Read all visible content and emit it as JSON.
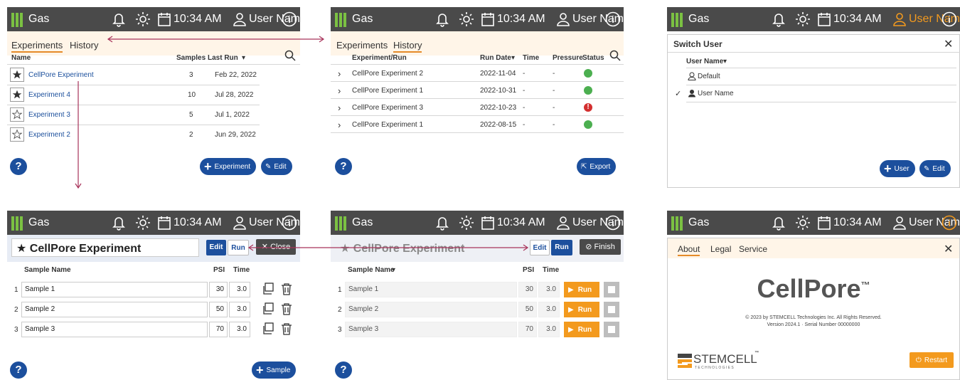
{
  "topbar": {
    "app_name": "Gas",
    "time": "10:34 AM",
    "user_name": "User Name",
    "accent_color": "#f39a1e",
    "bar_color": "#4a4a4a"
  },
  "tabs": {
    "experiments": "Experiments",
    "history": "History"
  },
  "experiments_list": {
    "col_name": "Name",
    "col_samples": "Samples",
    "col_last_run": "Last Run",
    "rows": [
      {
        "name": "CellPore Experiment",
        "samples": "3",
        "last_run": "Feb 22, 2022",
        "starred": true
      },
      {
        "name": "Experiment 4",
        "samples": "10",
        "last_run": "Jul 28, 2022",
        "starred": true
      },
      {
        "name": "Experiment 3",
        "samples": "5",
        "last_run": "Jul 1, 2022",
        "starred": false
      },
      {
        "name": "Experiment 2",
        "samples": "2",
        "last_run": "Jun 29, 2022",
        "starred": false
      }
    ],
    "add_button": "Experiment",
    "edit_button": "Edit"
  },
  "history_list": {
    "col_experiment": "Experiment/Run",
    "col_run_date": "Run Date",
    "col_time": "Time",
    "col_pressure": "Pressure",
    "col_status": "Status",
    "rows": [
      {
        "name": "CellPore Experiment 2",
        "date": "2022-11-04",
        "time": "-",
        "pressure": "-",
        "status": "ok"
      },
      {
        "name": "CellPore Experiment 1",
        "date": "2022-10-31",
        "time": "-",
        "pressure": "-",
        "status": "ok"
      },
      {
        "name": "CellPore Experiment 3",
        "date": "2022-10-23",
        "time": "-",
        "pressure": "-",
        "status": "error"
      },
      {
        "name": "CellPore Experiment 1",
        "date": "2022-08-15",
        "time": "-",
        "pressure": "-",
        "status": "ok"
      }
    ],
    "export_button": "Export"
  },
  "switch_user": {
    "title": "Switch User",
    "col_user": "User Name",
    "users": [
      "Default",
      "User Name"
    ],
    "add_button": "User",
    "edit_button": "Edit"
  },
  "edit_view": {
    "experiment_name": "CellPore Experiment",
    "edit_btn": "Edit",
    "run_btn": "Run",
    "close_btn": "Close",
    "col_sample": "Sample Name",
    "col_psi": "PSI",
    "col_time": "Time",
    "rows": [
      {
        "idx": "1",
        "name": "Sample 1",
        "psi": "30",
        "time": "3.0"
      },
      {
        "idx": "2",
        "name": "Sample 2",
        "psi": "50",
        "time": "3.0"
      },
      {
        "idx": "3",
        "name": "Sample 3",
        "psi": "70",
        "time": "3.0"
      }
    ],
    "add_sample": "Sample"
  },
  "run_view": {
    "experiment_name": "CellPore Experiment",
    "edit_btn": "Edit",
    "run_btn": "Run",
    "finish_btn": "Finish",
    "col_sample": "Sample Name",
    "col_psi": "PSI",
    "col_time": "Time",
    "row_run_label": "Run"
  },
  "about": {
    "tabs": [
      "About",
      "Legal",
      "Service"
    ],
    "product": "CellPore",
    "tm": "™",
    "copyright": "© 2023 by STEMCELL Technologies Inc. All Rights Reserved.",
    "version": "Version 2024.1 · Serial Number 00000000",
    "company": "STEMCELL",
    "company_sub": "T E C H N O L O G I E S",
    "company_tm": "™",
    "restart_btn": "Restart"
  },
  "help_label": "?"
}
